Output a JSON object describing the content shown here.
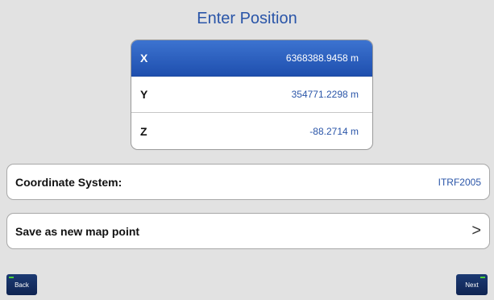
{
  "title": "Enter Position",
  "coordinates": [
    {
      "axis": "X",
      "value": "6368388.9458 m",
      "selected": true
    },
    {
      "axis": "Y",
      "value": "354771.2298 m",
      "selected": false
    },
    {
      "axis": "Z",
      "value": "-88.2714 m",
      "selected": false
    }
  ],
  "coordinate_system": {
    "label": "Coordinate System:",
    "value": "ITRF2005"
  },
  "save_point": {
    "label": "Save as new map point",
    "chevron": ">"
  },
  "nav": {
    "back_label": "Back",
    "next_label": "Next"
  }
}
